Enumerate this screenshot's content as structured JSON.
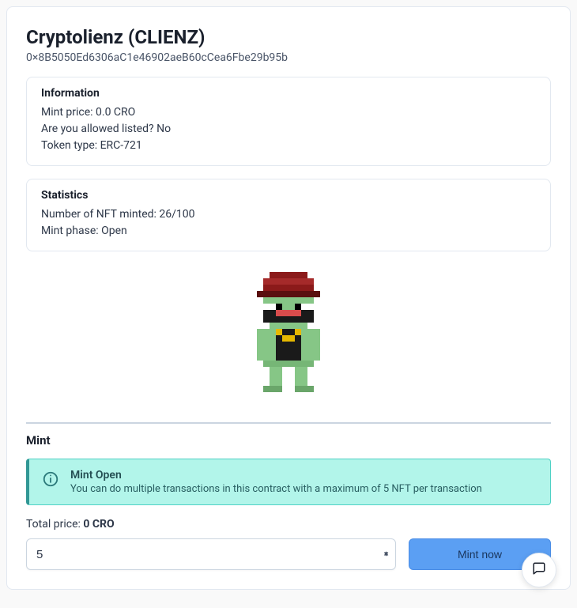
{
  "header": {
    "title": "Cryptolienz (CLIENZ)",
    "address": "0×8B5050Ed6306aC1e46902aeB60cCea6Fbe29b95b"
  },
  "info": {
    "heading": "Information",
    "mint_price_label": "Mint price: 0.0 CRO",
    "allowed_label": "Are you allowed listed? No",
    "token_type_label": "Token type: ERC-721"
  },
  "stats": {
    "heading": "Statistics",
    "minted_label": "Number of NFT minted: 26/100",
    "phase_label": "Mint phase: Open"
  },
  "mint": {
    "section_heading": "Mint",
    "alert_title": "Mint Open",
    "alert_desc": "You can do multiple transactions in this contract with a maximum of 5 NFT per transaction",
    "total_price_label": "Total price:",
    "total_price_value": "0 CRO",
    "quantity_value": "5",
    "button_label": "Mint now"
  },
  "colors": {
    "teal_bg": "#b2f5ea",
    "teal_border": "#4fd1c5",
    "btn_bg": "#5b9ff3"
  }
}
